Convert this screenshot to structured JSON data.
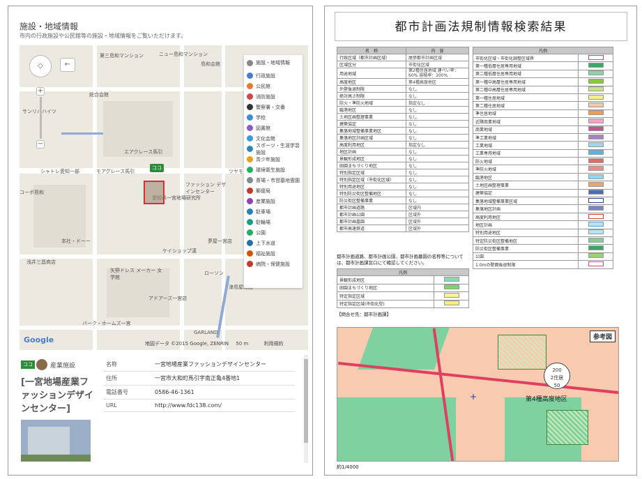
{
  "left": {
    "title": "施設・地域情報",
    "subtitle": "市内の行政施設や公民館等の施設・地域情報をご覧いただけます。",
    "map": {
      "labels": [
        "第三島和マンション",
        "ニュー島和マンション",
        "島和会館",
        "総合会館",
        "サンリバハイツ",
        "エアクレース馬引",
        "シャトレ愛知一部",
        "モアグレース馬引",
        "ツヤモ",
        "コーポ島和",
        "ファッション デザインセンター",
        "愛知県一宮地場研究所",
        "本社・ドーー",
        "夢屋一宮店",
        "ケイショップ漢",
        "浅井三昌商店",
        "矢野ドレス メーカー 女学館",
        "ローソン",
        "アドアーズ一宮店",
        "津島屋商店",
        "バーク・ホームズ一宮",
        "GARLAND",
        "利用規約"
      ],
      "marker_label": "ココ",
      "google": "Google",
      "attribution": "地図データ ©2015 Google, ZENRIN",
      "scale": "50 m",
      "terms": "利用規約"
    },
    "legend": [
      {
        "label": "施設・地域情報",
        "color": "#888888"
      },
      {
        "label": "行政施設",
        "color": "#4a7bd0"
      },
      {
        "label": "公民館",
        "color": "#e07b39"
      },
      {
        "label": "消防施設",
        "color": "#d64545"
      },
      {
        "label": "警察署・交番",
        "color": "#333333"
      },
      {
        "label": "学校",
        "color": "#3a8fd0"
      },
      {
        "label": "図書館",
        "color": "#8a5cc2"
      },
      {
        "label": "文化会館",
        "color": "#3b9ad9"
      },
      {
        "label": "スポーツ・生涯学習施設",
        "color": "#2e86c1"
      },
      {
        "label": "青少年施設",
        "color": "#e3a21a"
      },
      {
        "label": "環境衛生施設",
        "color": "#27ae60"
      },
      {
        "label": "斎場・市営墓地霊園",
        "color": "#7f8c8d"
      },
      {
        "label": "郵便局",
        "color": "#c0392b"
      },
      {
        "label": "産業施設",
        "color": "#8e44ad"
      },
      {
        "label": "駐車場",
        "color": "#2980b9"
      },
      {
        "label": "駐輪場",
        "color": "#16a085"
      },
      {
        "label": "公園",
        "color": "#27ae60"
      },
      {
        "label": "上下水道",
        "color": "#2471a3"
      },
      {
        "label": "福祉施設",
        "color": "#d35400"
      },
      {
        "label": "病院・保健施設",
        "color": "#c0392b"
      }
    ],
    "info": {
      "tag": "ココ",
      "category": "産業施設",
      "name": "[一宮地場産業ファッションデザインセンター]",
      "rows": [
        {
          "k": "名称",
          "v": "一宮地場産業ファッションデザインセンター"
        },
        {
          "k": "住所",
          "v": "一宮市大和町馬引字南正亀4番地1"
        },
        {
          "k": "電話番号",
          "v": "0586-46-1361"
        },
        {
          "k": "URL",
          "v": "http://www.fdc138.com/"
        }
      ]
    }
  },
  "right": {
    "title": "都市計画法規制情報検索結果",
    "table1": {
      "headers": [
        "名　称",
        "内　容"
      ],
      "rows": [
        [
          "行政区域（都市計画区域）",
          "尾張都市計画区域"
        ],
        [
          "区域区分",
          "市街化区域"
        ],
        [
          "用途地域",
          "第2種住居地域 建ぺい率：60% 容積率：200%"
        ],
        [
          "高度地区",
          "第4種高度地区"
        ],
        [
          "外壁後退制限",
          "なし"
        ],
        [
          "絶対高さ制限",
          "なし"
        ],
        [
          "防火・準防火地域",
          "指定なし"
        ],
        [
          "臨港地区",
          "なし"
        ],
        [
          "土地区画整理事業",
          "なし"
        ],
        [
          "建築協定",
          "なし"
        ],
        [
          "集落地域整備事業地区",
          "なし"
        ],
        [
          "集落地区計画区域",
          "なし"
        ],
        [
          "高度利用地区",
          "指定なし"
        ],
        [
          "地区計画",
          "なし"
        ],
        [
          "景観形成地区",
          "なし"
        ],
        [
          "田園まちづくり地区",
          "なし"
        ],
        [
          "特別指定区域",
          "なし"
        ],
        [
          "特別指定区域（市街化区域）",
          "なし"
        ],
        [
          "特別用途地区",
          "なし"
        ],
        [
          "特別防災街区整備地区",
          "なし"
        ],
        [
          "防災街区整備事業",
          "なし"
        ],
        [
          "都市計画道路",
          "区域内"
        ],
        [
          "都市計画公園",
          "区域外"
        ],
        [
          "都市計画墓園",
          "区域外"
        ],
        [
          "都市高速鉄道",
          "区域外"
        ]
      ]
    },
    "note": "都市計画道路、都市計画公園、都市計画墓園の名称等については、都市計画課窓口にて確認してください。",
    "legend2": {
      "header": "凡例",
      "items": [
        {
          "label": "市街化区域・市街化調整区域界",
          "color": "#ffffff",
          "border": "#d63c8c"
        },
        {
          "label": "第一種低層住居専用地域",
          "color": "#3aa864",
          "border": "#999"
        },
        {
          "label": "第二種低層住居専用地域",
          "color": "#8fd1a7",
          "border": "#999"
        },
        {
          "label": "第一種中高層住居専用地域",
          "color": "#8cc63f",
          "border": "#999"
        },
        {
          "label": "第二種中高層住居専用地域",
          "color": "#c8e28c",
          "border": "#999"
        },
        {
          "label": "第一種住居地域",
          "color": "#f4ef8a",
          "border": "#999"
        },
        {
          "label": "第二種住居地域",
          "color": "#f7c7a3",
          "border": "#999"
        },
        {
          "label": "準住居地域",
          "color": "#f39a4c",
          "border": "#999"
        },
        {
          "label": "近隣商業地域",
          "color": "#f5a3c7",
          "border": "#999"
        },
        {
          "label": "商業地域",
          "color": "#c4558f",
          "border": "#999"
        },
        {
          "label": "準工業地域",
          "color": "#a682c3",
          "border": "#999"
        },
        {
          "label": "工業地域",
          "color": "#9ed6f0",
          "border": "#999"
        },
        {
          "label": "工業専用地域",
          "color": "#4fb8e3",
          "border": "#999"
        },
        {
          "label": "防火地域",
          "color": "#e36a6a",
          "border": "#999"
        },
        {
          "label": "準防火地域",
          "color": "#f28a8a",
          "border": "#999"
        },
        {
          "label": "臨港地区",
          "color": "#8fd6f0",
          "border": "#999"
        },
        {
          "label": "土地区画整理事業",
          "color": "#f4a460",
          "border": "#999"
        },
        {
          "label": "建築協定",
          "color": "#4a6fb8",
          "border": "#999"
        },
        {
          "label": "集落地域整備事業区域",
          "color": "#ffffff",
          "border": "#2a3d8f"
        },
        {
          "label": "集落地区計画",
          "color": "#7a86c4",
          "border": "#999"
        },
        {
          "label": "高度利用地区",
          "color": "#ffffff",
          "border": "#d63c3c"
        },
        {
          "label": "地区計画",
          "color": "#bfe0f0",
          "border": "#5a9fd4"
        },
        {
          "label": "特別用途地区",
          "color": "#b6e3f2",
          "border": "#999"
        },
        {
          "label": "特定防災街区整備地区",
          "color": "#7ed098",
          "border": "#999"
        },
        {
          "label": "防災街区整備事業",
          "color": "#3aa864",
          "border": "#999"
        },
        {
          "label": "公園",
          "color": "#9bd17d",
          "border": "#999"
        },
        {
          "label": "1.0mの壁面後退制限",
          "color": "#ffffff",
          "border": "#e0457b"
        }
      ]
    },
    "legend3": {
      "header": "凡例",
      "items": [
        {
          "label": "景観形成地区",
          "color": "#8fd6b4"
        },
        {
          "label": "田園まちづくり地区",
          "color": "#7ed36e"
        },
        {
          "label": "特定指定区域",
          "color": "#f7f29a"
        },
        {
          "label": "特定指定区域(市街化型)",
          "color": "#f7ee7a"
        }
      ]
    },
    "contact": "【問合せ先：都市計画課】",
    "refmap": {
      "badge": "参考図",
      "zone": "第4種高度地区",
      "zone_value": "200",
      "zone_value2": "50",
      "zone_type": "2住居"
    },
    "scale": "約1/4000"
  }
}
